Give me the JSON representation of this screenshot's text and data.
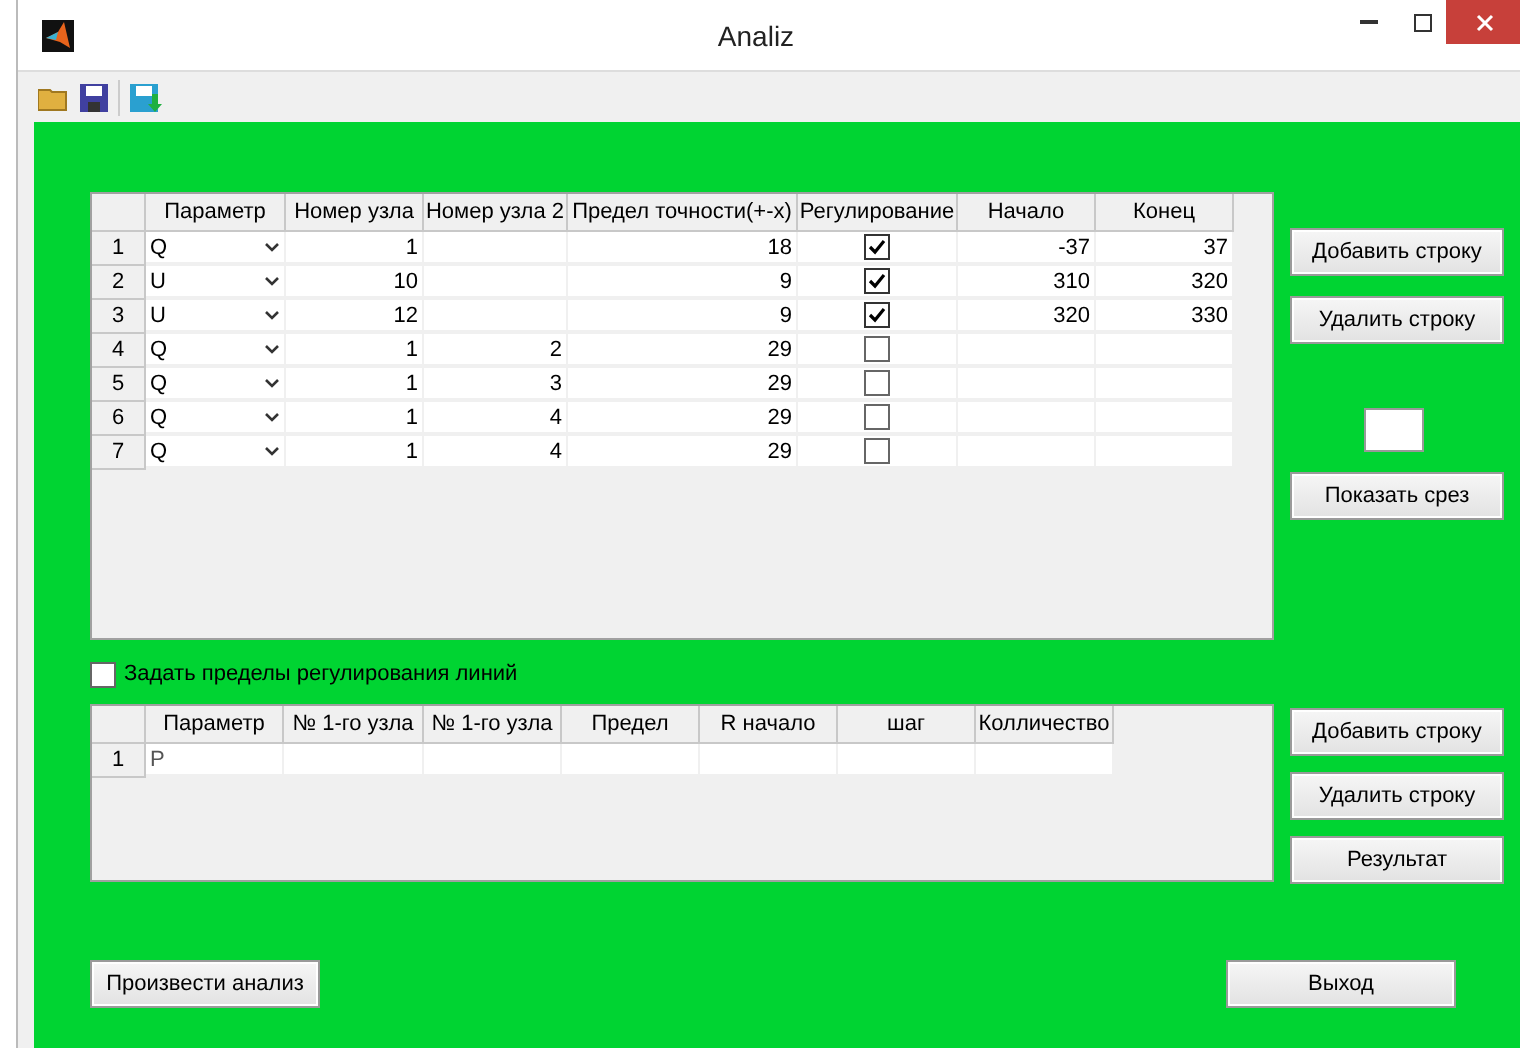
{
  "window": {
    "title": "Analiz"
  },
  "table_1": {
    "columns": [
      "Параметр",
      "Номер узла",
      "Номер узла 2",
      "Предел точности(+-x)",
      "Регулирование",
      "Начало",
      "Конец"
    ],
    "rows": [
      {
        "index": "1",
        "parameter": "Q",
        "node_1": "1",
        "node_2": "",
        "limit": "18",
        "regulation": true,
        "start": "-37",
        "end": "37"
      },
      {
        "index": "2",
        "parameter": "U",
        "node_1": "10",
        "node_2": "",
        "limit": "9",
        "regulation": true,
        "start": "310",
        "end": "320"
      },
      {
        "index": "3",
        "parameter": "U",
        "node_1": "12",
        "node_2": "",
        "limit": "9",
        "regulation": true,
        "start": "320",
        "end": "330"
      },
      {
        "index": "4",
        "parameter": "Q",
        "node_1": "1",
        "node_2": "2",
        "limit": "29",
        "regulation": false,
        "start": "",
        "end": ""
      },
      {
        "index": "5",
        "parameter": "Q",
        "node_1": "1",
        "node_2": "3",
        "limit": "29",
        "regulation": false,
        "start": "",
        "end": ""
      },
      {
        "index": "6",
        "parameter": "Q",
        "node_1": "1",
        "node_2": "4",
        "limit": "29",
        "regulation": false,
        "start": "",
        "end": ""
      },
      {
        "index": "7",
        "parameter": "Q",
        "node_1": "1",
        "node_2": "4",
        "limit": "29",
        "regulation": false,
        "start": "",
        "end": ""
      }
    ]
  },
  "side_buttons_1": [
    "Добавить строку",
    "Удалить строку"
  ],
  "slice_button": "Показать срез",
  "line_limits_checkbox": {
    "label": "Задать пределы регулирования линий",
    "checked": false
  },
  "table_2": {
    "columns": [
      "Параметр",
      "№ 1-го узла",
      "№ 1-го узла",
      "Предел",
      "R начало",
      "шаг",
      "Колличество"
    ],
    "rows": [
      {
        "index": "1",
        "cells": [
          "P",
          "",
          "",
          "",
          "",
          "",
          ""
        ]
      }
    ]
  },
  "side_buttons_2": [
    "Добавить строку",
    "Удалить строку",
    "Результат"
  ],
  "analyze_button": "Произвести анализ",
  "exit_button": "Выход"
}
